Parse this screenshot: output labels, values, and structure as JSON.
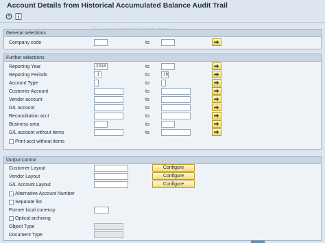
{
  "title": "Account Details from Historical Accumulated Balance Audit Trail",
  "watermark": "© www.tutorialkart.com",
  "toolbar": {
    "execute_icon": "execute-icon",
    "info_icon": "info-icon"
  },
  "colors": {
    "accent_button": "#f2d96a",
    "group_header": "#c9d6e2",
    "background": "#dde6ee"
  },
  "general": {
    "title": "General selections",
    "company_code": {
      "label": "Company code",
      "from": "",
      "to_label": "to",
      "to": ""
    }
  },
  "further": {
    "title": "Further selections",
    "reporting_year": {
      "label": "Reporting Year",
      "from": "2018",
      "to_label": "to",
      "to": ""
    },
    "reporting_periods": {
      "label": "Reporting Periods",
      "from": "1",
      "to_label": "to",
      "to": "16"
    },
    "account_type": {
      "label": "Account Type",
      "to_label": "to"
    },
    "customer_account": {
      "label": "Customer Account",
      "to_label": "to"
    },
    "vendor_account": {
      "label": "Vendor account",
      "to_label": "to"
    },
    "gl_account": {
      "label": "G/L account",
      "to_label": "to"
    },
    "reconciliation_acct": {
      "label": "Reconciliation acct",
      "to_label": "to"
    },
    "business_area": {
      "label": "Business area",
      "to_label": "to"
    },
    "gl_without_items": {
      "label": "G/L account without items",
      "to_label": "to"
    },
    "print_without_items": {
      "label": "Print acct without items",
      "checked": false
    }
  },
  "output": {
    "title": "Output control",
    "customer_layout": {
      "label": "Customer Layout",
      "button": "Configure"
    },
    "vendor_layout": {
      "label": "Vendor Layout",
      "button": "Configure"
    },
    "gl_layout": {
      "label": "G/L Account Layout",
      "button": "Configure"
    },
    "alt_account_number": {
      "label": "Alternative Account Number",
      "checked": false
    },
    "separate_list": {
      "label": "Separate list",
      "checked": false
    },
    "former_local_currency": {
      "label": "Former local currency"
    },
    "optical_archiving": {
      "label": "Optical archiving",
      "checked": false
    },
    "object_type": {
      "label": "Object Type"
    },
    "document_type": {
      "label": "Document Type"
    }
  }
}
